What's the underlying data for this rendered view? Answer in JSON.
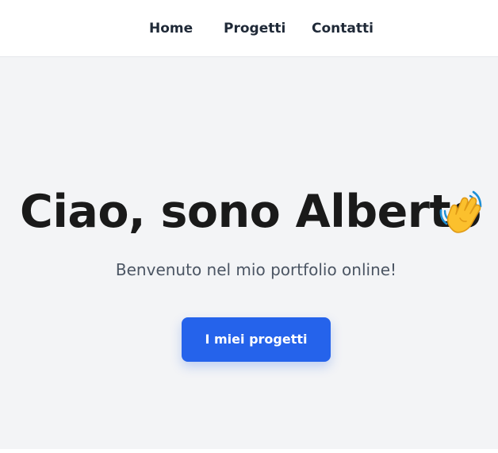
{
  "nav": {
    "items": [
      {
        "label": "Home"
      },
      {
        "label": "Progetti"
      },
      {
        "label": "Contatti"
      }
    ]
  },
  "hero": {
    "title": "Ciao, sono Alberto",
    "title_icon": "waving-hand-icon",
    "subtitle": "Benvenuto nel mio portfolio online!",
    "cta_label": "I miei progetti"
  },
  "colors": {
    "accent": "#2563eb",
    "hero_background": "#f3f4f6",
    "text_primary": "#1a1a1a",
    "text_secondary": "#4b5563",
    "nav_text": "#1f2937"
  }
}
